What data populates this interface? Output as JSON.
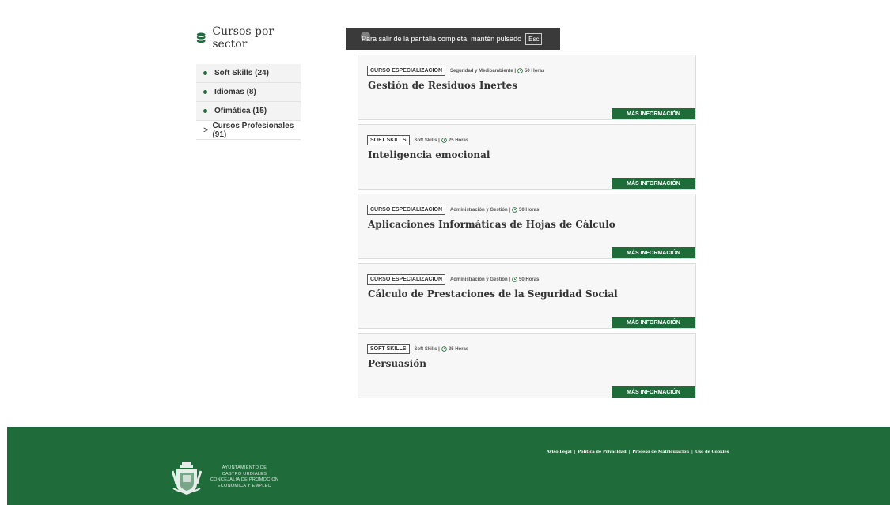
{
  "sidebar": {
    "title": "Cursos por sector",
    "items": [
      {
        "label": "Soft Skills (24)",
        "marker": "dot"
      },
      {
        "label": "Idiomas (8)",
        "marker": "dot"
      },
      {
        "label": "Ofimática (15)",
        "marker": "dot"
      },
      {
        "label": "Cursos Profesionales (91)",
        "marker": "chevron"
      }
    ]
  },
  "toast": {
    "message": "Para salir de la pantalla completa, mantén pulsado",
    "key": "Esc"
  },
  "courses": [
    {
      "tag": "CURSO ESPECIALIZACION",
      "sector": "Seguridad y Medioambiente |",
      "hours": "50 Horas",
      "title": "Gestión de Residuos Inertes",
      "button": "MÁS INFORMACIÓN"
    },
    {
      "tag": "SOFT SKILLS",
      "sector": "Soft Skills |",
      "hours": "25 Horas",
      "title": "Inteligencia emocional",
      "button": "MÁS INFORMACIÓN"
    },
    {
      "tag": "CURSO ESPECIALIZACION",
      "sector": "Administración y Gestión |",
      "hours": "50 Horas",
      "title": "Aplicaciones Informáticas de Hojas de Cálculo",
      "button": "MÁS INFORMACIÓN"
    },
    {
      "tag": "CURSO ESPECIALIZACION",
      "sector": "Administración y Gestión |",
      "hours": "50 Horas",
      "title": "Cálculo de Prestaciones de la Seguridad Social",
      "button": "MÁS INFORMACIÓN"
    },
    {
      "tag": "SOFT SKILLS",
      "sector": "Soft Skills |",
      "hours": "25 Horas",
      "title": "Persuasión",
      "button": "MÁS INFORMACIÓN"
    }
  ],
  "footer": {
    "links": [
      "Aviso Legal",
      "Política de Privacidad",
      "Proceso de Matriculación",
      "Uso de Cookies"
    ],
    "separator": "|",
    "org_lines": [
      "AYUNTAMIENTO DE",
      "CASTRO URDIALES",
      "CONCEJALÍA DE PROMOCIÓN",
      "ECONÓMICA Y EMPLEO"
    ]
  },
  "colors": {
    "brand_green": "#1f6b3a",
    "card_bg": "#f7f7f7",
    "sidebar_bg": "#f3f3f3"
  },
  "icons": {
    "sidebar_title": "database-icon",
    "hours": "clock-icon",
    "collapsed": "chevron-right-icon",
    "crest": "coat-of-arms-logo"
  }
}
